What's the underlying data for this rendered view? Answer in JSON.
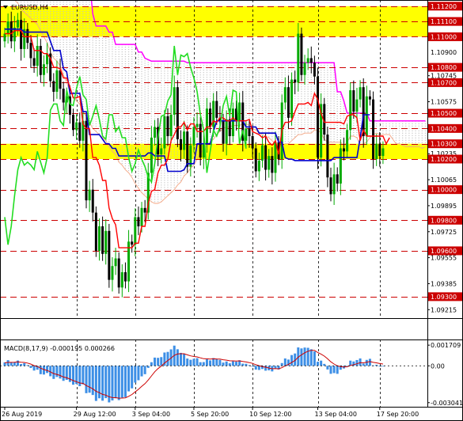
{
  "window": {
    "title": "EURUSD,H4",
    "dropdown_icon": "triangle-down-icon"
  },
  "price_axis": {
    "grey_labels": [
      "1.10745",
      "1.10575",
      "1.10405",
      "1.10235",
      "1.10065",
      "1.09895",
      "1.09725",
      "1.09555",
      "1.09385",
      "1.09215"
    ],
    "grey_prices": [
      1.10745,
      1.10575,
      1.10405,
      1.10235,
      1.10065,
      1.09895,
      1.09725,
      1.09555,
      1.09385,
      1.09215
    ],
    "level_labels": [
      "1.11200",
      "1.11100",
      "1.11000",
      "1.10900",
      "1.10800",
      "1.10700",
      "1.10500",
      "1.10400",
      "1.10300",
      "1.10200",
      "1.10000",
      "1.09800",
      "1.09600",
      "1.09300"
    ],
    "level_prices": [
      1.112,
      1.111,
      1.11,
      1.109,
      1.108,
      1.107,
      1.105,
      1.104,
      1.103,
      1.102,
      1.1,
      1.098,
      1.096,
      1.093
    ],
    "level_boxed": [
      true,
      true,
      true,
      false,
      true,
      true,
      true,
      true,
      true,
      true,
      true,
      true,
      true,
      true
    ],
    "level_dashed": [
      true,
      true,
      true,
      false,
      true,
      true,
      true,
      true,
      true,
      true,
      true,
      true,
      true,
      true
    ]
  },
  "zones": [
    {
      "name": "resistance-zone",
      "from": 1.11,
      "to": 1.112,
      "color": "#ffff00"
    },
    {
      "name": "support-zone",
      "from": 1.102,
      "to": 1.103,
      "color": "#ffff00"
    }
  ],
  "macd": {
    "label": "MACD(8,17,9) -0.000195 0.000266",
    "axis_labels": [
      "0.001709",
      "0.00",
      "-0.003041"
    ],
    "axis_values": [
      0.001709,
      0,
      -0.003041
    ]
  },
  "time_axis": {
    "labels": [
      "26 Aug 2019",
      "29 Aug 12:00",
      "3 Sep 04:00",
      "5 Sep 20:00",
      "10 Sep 12:00",
      "13 Sep 04:00",
      "17 Sep 20:00"
    ],
    "bar_index": [
      0,
      22,
      40,
      58,
      76,
      96,
      115
    ]
  },
  "colors": {
    "bull": "#00aa00",
    "bear": "#000000",
    "tenkan": "#ff0000",
    "kijun": "#0000cc",
    "chikou": "#22dd22",
    "senkou_b": "#ff00ff",
    "cloud_up": "#f4a582",
    "cloud_dn": "#c0c0c0",
    "macd_hist": "#3d8fe6",
    "macd_signal": "#cc0000",
    "level": "#cc0000"
  },
  "series": {
    "close": [
      1.1102,
      1.111,
      1.1097,
      1.1106,
      1.1111,
      1.1092,
      1.1105,
      1.1096,
      1.1086,
      1.1081,
      1.1094,
      1.1075,
      1.1082,
      1.1089,
      1.1071,
      1.1064,
      1.1078,
      1.1066,
      1.1057,
      1.1061,
      1.1049,
      1.1039,
      1.1044,
      1.1032,
      1.1045,
      1.0993,
      1.1,
      1.0985,
      1.096,
      1.0976,
      1.0958,
      1.0973,
      1.0941,
      1.095,
      1.0955,
      1.0936,
      1.0946,
      1.094,
      1.0966,
      1.0964,
      1.0982,
      1.0976,
      1.0988,
      1.0985,
      1.1011,
      1.1034,
      1.1041,
      1.1023,
      1.1027,
      1.1048,
      1.1035,
      1.1049,
      1.1067,
      1.1033,
      1.1026,
      1.1038,
      1.1015,
      1.1029,
      1.1041,
      1.1043,
      1.1021,
      1.103,
      1.1053,
      1.1041,
      1.1058,
      1.1047,
      1.1045,
      1.103,
      1.1046,
      1.1035,
      1.1053,
      1.1045,
      1.1057,
      1.1032,
      1.104,
      1.1035,
      1.1027,
      1.1012,
      1.1019,
      1.1029,
      1.1013,
      1.1022,
      1.1011,
      1.1031,
      1.102,
      1.1057,
      1.1067,
      1.1047,
      1.1072,
      1.107,
      1.1102,
      1.1075,
      1.1083,
      1.1086,
      1.1083,
      1.1074,
      1.1021,
      1.1056,
      1.1036,
      1.1008,
      1.0997,
      1.101,
      1.1004,
      1.1027,
      1.1025,
      1.1039,
      1.1065,
      1.1051,
      1.1059,
      1.1067,
      1.1035,
      1.1061,
      1.1059,
      1.102,
      1.103,
      1.1022,
      1.1027
    ],
    "chikou": [
      1.0982,
      1.0964,
      1.0976,
      1.0996,
      1.1013,
      1.1021,
      1.1016,
      1.1018,
      1.1016,
      1.1013,
      1.1025,
      1.1018,
      1.1011,
      1.1021,
      1.1052,
      1.1056,
      1.1056,
      1.1045,
      1.1042,
      1.1065,
      1.1056,
      1.1055,
      1.1066,
      1.1074,
      1.1062,
      1.1059,
      1.1042,
      1.1048,
      1.1055,
      1.1046,
      1.1035,
      1.1033,
      1.1049,
      1.1049,
      1.1038,
      1.1041,
      1.1034,
      1.1034,
      1.1021,
      1.1012,
      1.1017,
      1.1026,
      1.102,
      1.1015,
      1.1008,
      1.1005,
      1.1017,
      1.1034,
      1.1048,
      1.1049,
      1.1058,
      1.1062,
      1.1094,
      1.1075,
      1.1088,
      1.1087,
      1.1089,
      1.108,
      1.1073,
      1.1064,
      1.1049,
      1.1039,
      1.1011,
      1.1025,
      1.1039,
      1.1035,
      1.1041,
      1.1055,
      1.1061,
      1.1048,
      1.1065,
      1.1064,
      1.103,
      1.1039,
      1.1027
    ],
    "kijun": [
      1.1105,
      1.1105,
      1.1105,
      1.1105,
      1.1105,
      1.1105,
      1.1103,
      1.1103,
      1.1103,
      1.1103,
      1.1103,
      1.1103,
      1.1103,
      1.1103,
      1.1097,
      1.1091,
      1.1091,
      1.1091,
      1.1079,
      1.1077,
      1.1063,
      1.1063,
      1.1063,
      1.1063,
      1.1051,
      1.1051,
      1.1036,
      1.1036,
      1.1036,
      1.1036,
      1.1033,
      1.103,
      1.103,
      1.1027,
      1.1027,
      1.1022,
      1.1022,
      1.1022,
      1.1022,
      1.1022,
      1.1022,
      1.1022,
      1.1022,
      1.1022,
      1.1024,
      1.1024,
      1.1022,
      1.1022,
      1.1022,
      1.1022,
      1.1012,
      1.1012,
      1.1012,
      1.1012,
      1.1012,
      1.1013,
      1.1017,
      1.1017,
      1.1017,
      1.103,
      1.103,
      1.103,
      1.103,
      1.103,
      1.1038,
      1.1045,
      1.1045,
      1.1045,
      1.1045,
      1.1045,
      1.1045,
      1.1045,
      1.1045,
      1.1045,
      1.1041,
      1.1041,
      1.1041,
      1.1041,
      1.1037,
      1.1037,
      1.1037,
      1.1037,
      1.1037,
      1.1037,
      1.1031,
      1.1031,
      1.1021,
      1.102,
      1.102,
      1.1019,
      1.1019,
      1.1019,
      1.1019,
      1.1019,
      1.1019,
      1.1019,
      1.1019,
      1.1019,
      1.1019,
      1.1019,
      1.1019,
      1.1021,
      1.1021,
      1.1021,
      1.1021,
      1.1021,
      1.1021,
      1.1021,
      1.1021,
      1.1034,
      1.1049,
      1.1049,
      1.1049
    ],
    "tenkan": [
      1.1102,
      1.1102,
      1.1102,
      1.1104,
      1.1104,
      1.1104,
      1.11,
      1.11,
      1.11,
      1.1091,
      1.1091,
      1.1091,
      1.1089,
      1.1089,
      1.1086,
      1.108,
      1.108,
      1.1079,
      1.1073,
      1.1073,
      1.1067,
      1.106,
      1.106,
      1.1061,
      1.1043,
      1.104,
      1.104,
      1.1021,
      1.1021,
      1.1016,
      1.1006,
      1.1006,
      1.0988,
      1.0981,
      1.0977,
      1.0962,
      1.0962,
      1.0962,
      1.0962,
      1.0962,
      1.0965,
      1.0965,
      1.0976,
      1.0976,
      1.0991,
      1.0999,
      1.1,
      1.1011,
      1.1016,
      1.1016,
      1.102,
      1.1032,
      1.1036,
      1.1041,
      1.1041,
      1.1044,
      1.1039,
      1.1043,
      1.1043,
      1.1038,
      1.1038,
      1.1038,
      1.1041,
      1.1041,
      1.1045,
      1.1044,
      1.1047,
      1.1047,
      1.1045,
      1.1045,
      1.1047,
      1.1045,
      1.1045,
      1.1045,
      1.1045,
      1.1046,
      1.1038,
      1.1037,
      1.1036,
      1.1034,
      1.1035,
      1.1031,
      1.1029,
      1.1032,
      1.1023,
      1.1039,
      1.1044,
      1.1044,
      1.1045,
      1.1051,
      1.1056,
      1.1056,
      1.1056,
      1.1057,
      1.1055,
      1.1063,
      1.1059,
      1.105,
      1.1044,
      1.1044,
      1.1044,
      1.1044,
      1.1044,
      1.1044,
      1.1043,
      1.1048,
      1.1049,
      1.1049,
      1.1047,
      1.1032,
      1.1039,
      1.1035,
      1.1035,
      1.1035,
      1.1035,
      1.1035,
      1.1035,
      1.103,
      1.1034
    ],
    "senkou_a": [
      1.1145,
      1.1135,
      1.1128,
      1.1124,
      1.1122,
      1.1118,
      1.1116,
      1.1114,
      1.1112,
      1.111,
      1.1108,
      1.1104,
      1.11,
      1.1096,
      1.109,
      1.1086,
      1.1084,
      1.1081,
      1.1075,
      1.107,
      1.1064,
      1.1061,
      1.1058,
      1.1056,
      1.1051,
      1.1048,
      1.1044,
      1.104,
      1.1038,
      1.1036,
      1.1034,
      1.1032,
      1.1028,
      1.1025,
      1.1023,
      1.1018,
      1.1016,
      1.1013,
      1.1011,
      1.1008,
      1.1004,
      1.1001,
      1.0998,
      1.0996,
      1.0994,
      1.0992,
      1.0991,
      1.0991,
      1.0992,
      1.0994,
      1.0996,
      1.0998,
      1.1,
      1.1003,
      1.1005,
      1.1009,
      1.1011,
      1.1014,
      1.1016,
      1.102,
      1.1024,
      1.1026,
      1.1029,
      1.1031,
      1.1033,
      1.1036,
      1.1038,
      1.104,
      1.1041,
      1.1041,
      1.1042,
      1.1042,
      1.1042,
      1.1043,
      1.1043,
      1.1042,
      1.104,
      1.1039,
      1.1037,
      1.1036,
      1.1035,
      1.1034,
      1.1032,
      1.103,
      1.1028,
      1.1029,
      1.103,
      1.103,
      1.1032,
      1.1034,
      1.1036,
      1.1036,
      1.1037,
      1.1037,
      1.1037,
      1.1039,
      1.1039,
      1.1037,
      1.1033,
      1.1031,
      1.1031,
      1.1031,
      1.1031,
      1.1031,
      1.1029,
      1.1031,
      1.1035,
      1.1035,
      1.1034,
      1.1029,
      1.103,
      1.1031,
      1.1034,
      1.1036,
      1.1037,
      1.1036,
      1.1036,
      1.1036,
      1.1036,
      1.1033,
      1.103,
      1.103,
      1.1029,
      1.1028,
      1.1028,
      1.1028,
      1.1028,
      1.1028,
      1.1027,
      1.1028,
      1.1028,
      1.1028,
      1.1028,
      1.103,
      1.1032,
      1.1032,
      1.1035,
      1.1033
    ],
    "senkou_b": [
      1.1145,
      1.114,
      1.1137,
      1.1137,
      1.1137,
      1.1137,
      1.1137,
      1.1137,
      1.1137,
      1.1137,
      1.1137,
      1.1137,
      1.1137,
      1.1137,
      1.1137,
      1.1137,
      1.1137,
      1.1137,
      1.1137,
      1.1137,
      1.1137,
      1.1137,
      1.1137,
      1.1137,
      1.1137,
      1.1137,
      1.1137,
      1.1115,
      1.1107,
      1.1107,
      1.1107,
      1.1107,
      1.1103,
      1.1103,
      1.1095,
      1.1095,
      1.1095,
      1.1095,
      1.1095,
      1.1095,
      1.1095,
      1.109,
      1.109,
      1.1086,
      1.1085,
      1.1084,
      1.1084,
      1.1084,
      1.1084,
      1.1084,
      1.1084,
      1.1084,
      1.1084,
      1.1084,
      1.1084,
      1.1084,
      1.1083,
      1.1083,
      1.1083,
      1.1083,
      1.1083,
      1.1083,
      1.1083,
      1.1083,
      1.1083,
      1.1083,
      1.1083,
      1.1083,
      1.1083,
      1.1083,
      1.1083,
      1.1083,
      1.1083,
      1.1083,
      1.1083,
      1.1083,
      1.1083,
      1.1083,
      1.1083,
      1.1083,
      1.1083,
      1.1083,
      1.1083,
      1.1083,
      1.1083,
      1.1083,
      1.1083,
      1.1083,
      1.1083,
      1.1083,
      1.1083,
      1.1083,
      1.1083,
      1.1083,
      1.1083,
      1.1083,
      1.1083,
      1.1083,
      1.1083,
      1.1083,
      1.1083,
      1.1083,
      1.1064,
      1.1064,
      1.1058,
      1.105,
      1.105,
      1.105,
      1.105,
      1.105,
      1.105,
      1.105,
      1.1045,
      1.1045,
      1.1045,
      1.1045,
      1.1045,
      1.1045,
      1.1045,
      1.1045,
      1.1045,
      1.1045,
      1.1045,
      1.1045,
      1.1045,
      1.1045,
      1.1045,
      1.1045,
      1.1045,
      1.1045,
      1.1045,
      1.1045,
      1.1045,
      1.1045,
      1.1045,
      1.1045
    ],
    "macd_hist": [
      0.00029,
      0.00047,
      0.00031,
      0.00031,
      0.00044,
      0.00015,
      0.00022,
      6e-05,
      -0.00018,
      -0.00039,
      -0.00032,
      -0.00069,
      -0.00072,
      -0.00059,
      -0.00086,
      -0.00108,
      -0.00092,
      -0.00105,
      -0.00124,
      -0.00116,
      -0.00133,
      -0.00156,
      -0.0015,
      -0.00168,
      -0.00153,
      -0.00226,
      -0.00222,
      -0.00241,
      -0.0029,
      -0.00268,
      -0.00288,
      -0.00267,
      -0.00302,
      -0.00286,
      -0.00268,
      -0.00283,
      -0.00263,
      -0.00259,
      -0.00211,
      -0.00186,
      -0.00139,
      -0.00119,
      -0.00087,
      -0.00069,
      -0.00017,
      0.0003,
      0.00068,
      0.00066,
      0.00072,
      0.0011,
      0.00115,
      0.00136,
      0.00167,
      0.00137,
      0.00107,
      0.00098,
      0.0006,
      0.0005,
      0.00058,
      0.00063,
      0.0003,
      0.00031,
      0.00054,
      0.00045,
      0.00064,
      0.00055,
      0.00049,
      0.00027,
      0.00036,
      0.00021,
      0.00037,
      0.00034,
      0.00046,
      0.00018,
      0.00017,
      6e-05,
      -7e-05,
      -0.00031,
      -0.00034,
      -0.00026,
      -0.0004,
      -0.00037,
      -0.00046,
      -0.0002,
      -0.0003,
      0.00023,
      0.00061,
      0.00052,
      0.00089,
      0.00102,
      0.00152,
      0.00144,
      0.00151,
      0.00149,
      0.00137,
      0.00119,
      0.00034,
      0.00043,
      0.00016,
      -0.0003,
      -0.00066,
      -0.0006,
      -0.00066,
      -0.00032,
      -0.00022,
      -1e-05,
      0.00043,
      0.00036,
      0.00048,
      0.00061,
      0.00019,
      0.00049,
      0.00058,
      4e-05,
      9e-05,
      -6e-05,
      -1e-05
    ],
    "macd_signal": [
      0.00025,
      0.00029,
      0.00029,
      0.0003,
      0.00033,
      0.0003,
      0.00028,
      0.00023,
      0.00014,
      2e-05,
      -5e-05,
      -0.00019,
      -0.00031,
      -0.00038,
      -0.0005,
      -0.00064,
      -0.00071,
      -0.0008,
      -0.00092,
      -0.00099,
      -0.00109,
      -0.00122,
      -0.00131,
      -0.00142,
      -0.00145,
      -0.00163,
      -0.00176,
      -0.0019,
      -0.0021,
      -0.00222,
      -0.00236,
      -0.00242,
      -0.00256,
      -0.00262,
      -0.00263,
      -0.00267,
      -0.00266,
      -0.00264,
      -0.00252,
      -0.00237,
      -0.00215,
      -0.00194,
      -0.0017,
      -0.00147,
      -0.00117,
      -0.00083,
      -0.00049,
      -0.00023,
      -2e-05,
      0.00023,
      0.00044,
      0.00064,
      0.00087,
      0.00098,
      0.001,
      0.001,
      0.00091,
      0.00082,
      0.00077,
      0.00074,
      0.00066,
      0.00059,
      0.00058,
      0.00056,
      0.00058,
      0.00057,
      0.00056,
      0.0005,
      0.00047,
      0.00042,
      0.00041,
      0.00039,
      0.00041,
      0.00036,
      0.00032,
      0.00027,
      0.0002,
      9e-05,
      1e-05,
      -5e-05,
      -0.00012,
      -0.00018,
      -0.00024,
      -0.00023,
      -0.00025,
      -0.00015,
      -0.0,
      0.00011,
      0.00029,
      0.00044,
      0.00072,
      0.00091,
      0.00108,
      0.00121,
      0.00128,
      0.00128,
      0.0011,
      0.00097,
      0.0008,
      0.00058,
      0.00033,
      0.00015,
      0.0,
      -6e-05,
      -9e-05,
      -8e-05,
      3e-05,
      0.0001,
      0.00017,
      0.00026,
      0.00025,
      0.0003,
      0.00035,
      0.00029,
      0.00025,
      0.00019,
      0.00015
    ]
  }
}
